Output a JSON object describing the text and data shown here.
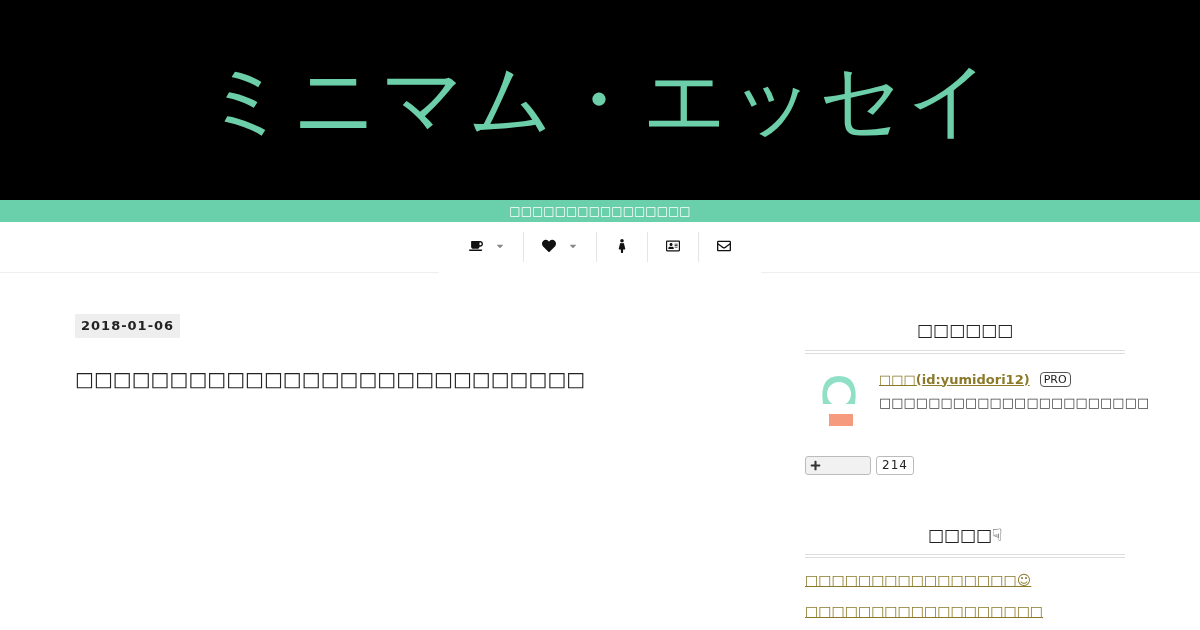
{
  "header": {
    "logo": "ミニマム・エッセイ",
    "tagline": "□□□□□□□□□□□□□□□□"
  },
  "nav": [
    {
      "kind": "coffee",
      "dropdown": true
    },
    {
      "kind": "heart",
      "dropdown": true
    },
    {
      "kind": "person",
      "dropdown": false
    },
    {
      "kind": "card",
      "dropdown": false
    },
    {
      "kind": "mail",
      "dropdown": false
    }
  ],
  "article": {
    "date": "2018-01-06",
    "title": "□□□□□□□□□□□□□□□□□□□□□□□□□□□"
  },
  "profile": {
    "heading": "□□□□□□",
    "name": "□□□(id:yumidori12)",
    "badge": "PRO",
    "description": "□□□□□□□□□□□□□□□□□□□□□□",
    "follow_count": "214"
  },
  "featured": {
    "heading": "□□□□☟",
    "links": [
      "□□□□□□□□□□□□□□□□☺",
      "□□□□□□□□□□□□□□□□□□"
    ]
  }
}
